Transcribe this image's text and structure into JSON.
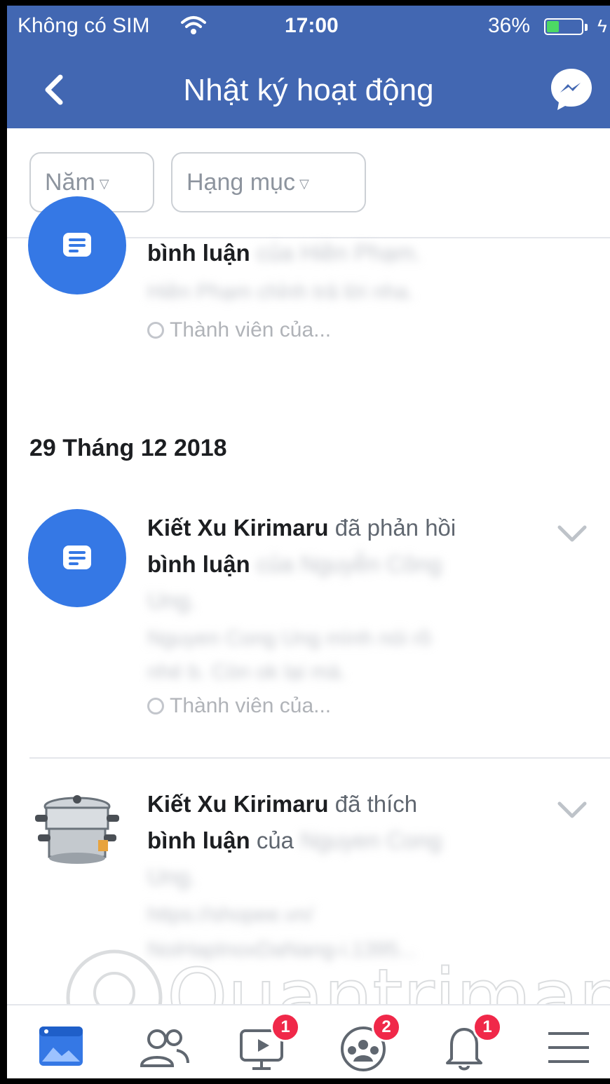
{
  "status_bar": {
    "carrier": "Không có SIM",
    "time": "17:00",
    "battery": "36%",
    "battery_level": 0.36
  },
  "header": {
    "title": "Nhật ký hoạt động",
    "back_icon": "chevron-left-icon",
    "messenger_icon": "messenger-icon"
  },
  "filters": {
    "year_label": "Năm",
    "category_label": "Hạng mục"
  },
  "colors": {
    "brand": "#4267b2",
    "accent": "#3578e5",
    "badge": "#f02849"
  },
  "entries": [
    {
      "line1_bold": "bình luận",
      "line1_rest": "của Hiền Phạm.",
      "preview": "Hiền Phạm chỉnh trả lời nha.",
      "audience": "Thành viên của..."
    },
    {
      "date": "29 Tháng 12 2018",
      "actor": "Kiết Xu Kirimaru",
      "action": "đã phản hồi",
      "line2_bold": "bình luận",
      "line2_rest": "của Nguyễn Công",
      "line3": "Ung.",
      "preview1": "Nguyen Cong Ung mình nói rồ",
      "preview2": "nhé b. Còn ok lại mà.",
      "audience": "Thành viên của..."
    },
    {
      "actor": "Kiết Xu Kirimaru",
      "action": "đã thích",
      "line2_bold": "bình luận",
      "line2_rest": "của",
      "line2_blur": "Nguyen Cong",
      "line3": "Ung.",
      "preview1": "https://shopee.vn/",
      "preview2": "NoiHapInoxDaNang-i.1395..."
    }
  ],
  "tabbar": {
    "tabs": [
      {
        "name": "news-feed-tab",
        "icon": "news-feed-icon"
      },
      {
        "name": "friends-tab",
        "icon": "friends-icon"
      },
      {
        "name": "watch-tab",
        "icon": "video-icon",
        "badge": "1"
      },
      {
        "name": "groups-tab",
        "icon": "groups-icon",
        "badge": "2"
      },
      {
        "name": "notifications-tab",
        "icon": "bell-icon",
        "badge": "1"
      },
      {
        "name": "menu-tab",
        "icon": "menu-icon"
      }
    ]
  },
  "watermark": {
    "text": "Quantrimang"
  }
}
